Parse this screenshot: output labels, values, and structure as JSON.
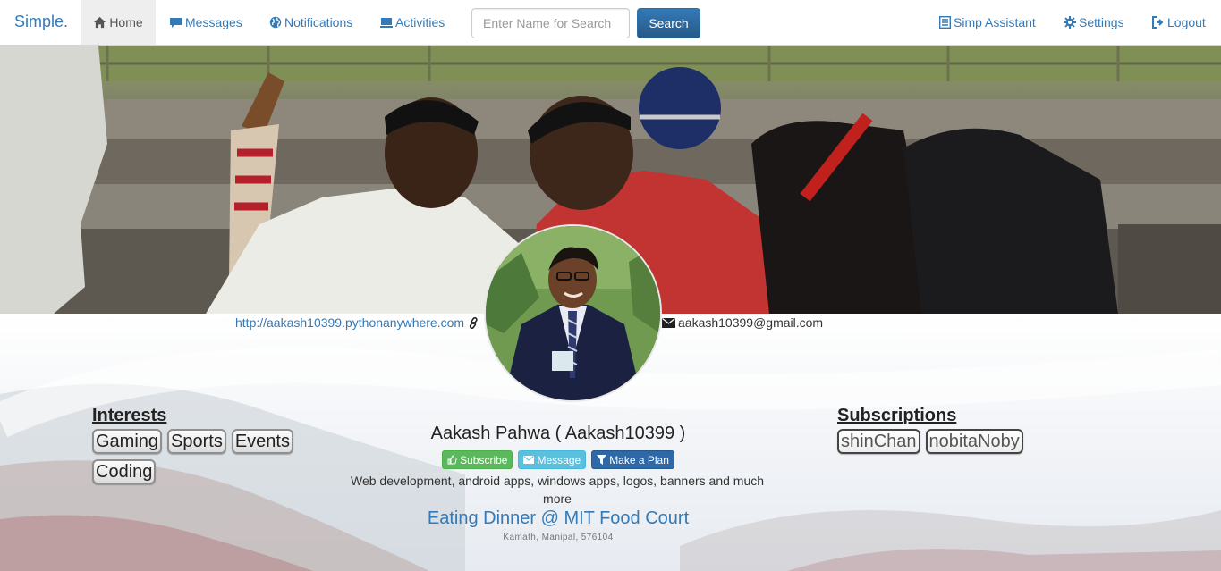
{
  "navbar": {
    "brand": "Simple.",
    "items": [
      {
        "label": "Home",
        "icon": "home-icon",
        "active": true
      },
      {
        "label": "Messages",
        "icon": "comment-icon",
        "active": false
      },
      {
        "label": "Notifications",
        "icon": "globe-icon",
        "active": false
      },
      {
        "label": "Activities",
        "icon": "monitor-icon",
        "active": false
      }
    ],
    "search": {
      "placeholder": "Enter Name for Search",
      "value": "",
      "button_label": "Search"
    },
    "right_items": [
      {
        "label": "Simp Assistant",
        "icon": "list-alt-icon"
      },
      {
        "label": "Settings",
        "icon": "cog-icon"
      },
      {
        "label": "Logout",
        "icon": "logout-icon"
      }
    ]
  },
  "profile": {
    "website": "http://aakash10399.pythonanywhere.com",
    "email": "aakash10399@gmail.com",
    "name": "Aakash Pahwa ( Aakash10399 )",
    "actions": [
      {
        "label": "Subscribe",
        "icon": "thumbs-up-icon",
        "color": "#5cb85c"
      },
      {
        "label": "Message",
        "icon": "envelope-icon",
        "color": "#5bc0de"
      },
      {
        "label": "Make a Plan",
        "icon": "filter-icon",
        "color": "#2f68a6"
      }
    ],
    "bio": "Web development, android apps, windows apps, logos, banners and much more",
    "status": "Eating Dinner @ MIT Food Court",
    "location": "Kamath, Manipal, 576104"
  },
  "interests": {
    "heading": "Interests",
    "items": [
      "Gaming",
      "Sports",
      "Events",
      "Coding"
    ]
  },
  "subscriptions": {
    "heading": "Subscriptions",
    "items": [
      "shinChan",
      "nobitaNoby"
    ]
  },
  "colors": {
    "link": "#337ab7",
    "primary_button": "#2e6da4",
    "success": "#5cb85c",
    "info": "#5bc0de"
  }
}
